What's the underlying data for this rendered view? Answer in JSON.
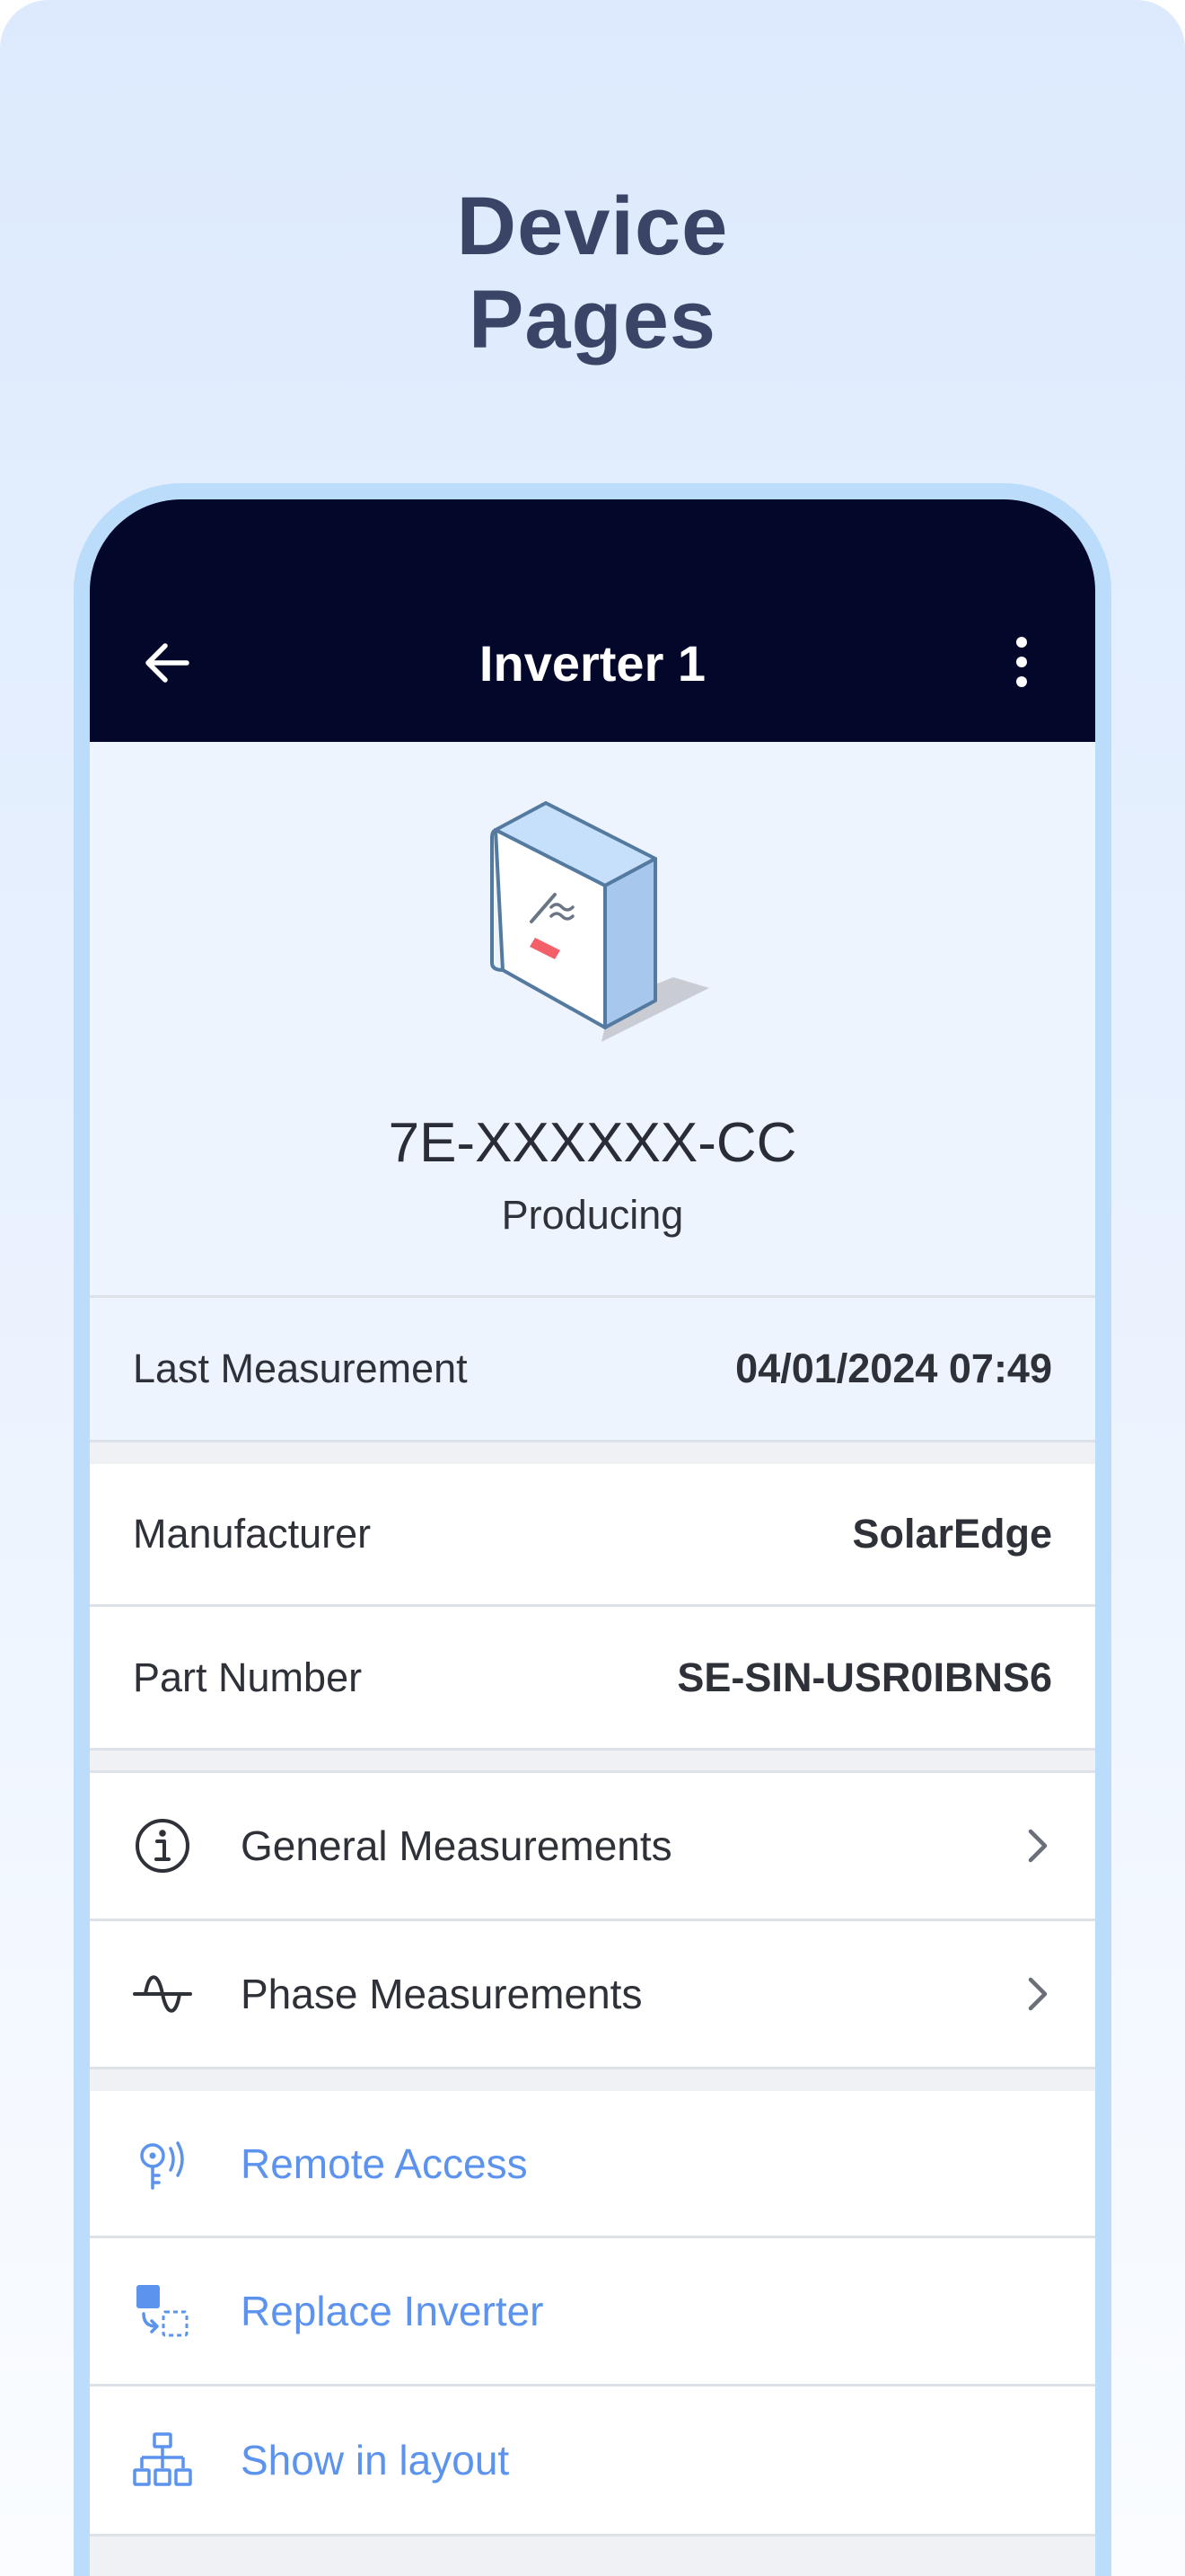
{
  "headline": {
    "line1": "Device",
    "line2": "Pages"
  },
  "appbar": {
    "title": "Inverter 1",
    "back_icon": "arrow-left-icon",
    "more_icon": "more-vertical-icon"
  },
  "device": {
    "serial": "7E-XXXXXX-CC",
    "status": "Producing",
    "image_icon": "inverter-device-icon"
  },
  "measurement": {
    "label": "Last Measurement",
    "value": "04/01/2024 07:49"
  },
  "details": [
    {
      "label": "Manufacturer",
      "value": "SolarEdge"
    },
    {
      "label": "Part Number",
      "value": "SE-SIN-USR0IBNS6"
    }
  ],
  "nav_items": [
    {
      "label": "General Measurements",
      "icon": "info-circle-icon"
    },
    {
      "label": "Phase Measurements",
      "icon": "sine-wave-icon"
    }
  ],
  "actions": [
    {
      "label": "Remote Access",
      "icon": "remote-key-icon"
    },
    {
      "label": "Replace Inverter",
      "icon": "replace-icon"
    },
    {
      "label": "Show in layout",
      "icon": "layout-tree-icon"
    }
  ],
  "colors": {
    "appbar": "#03082b",
    "link": "#5b93ee",
    "frame": "#bcdcfc",
    "headline": "#3a4466"
  }
}
